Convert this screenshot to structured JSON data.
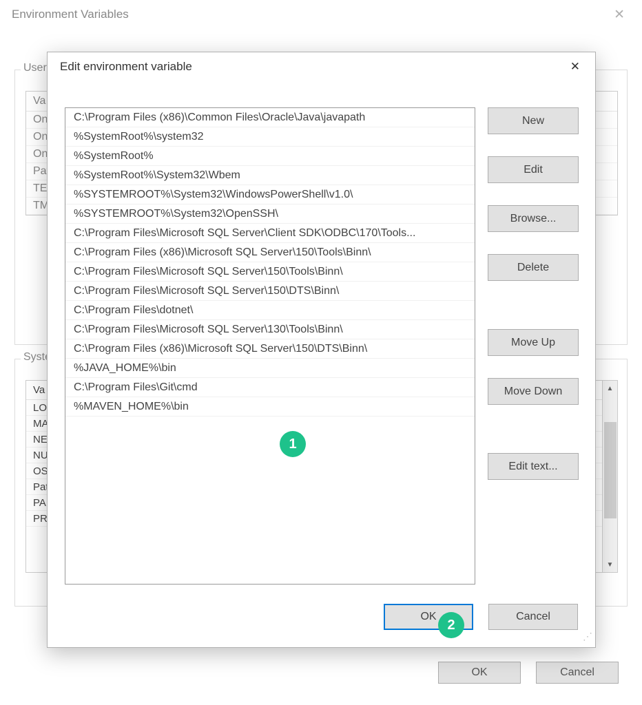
{
  "parent": {
    "title": "Environment Variables",
    "user_group_label": "User",
    "system_group_label": "Syste",
    "user_vars_header": "Va",
    "user_vars": [
      "On",
      "On",
      "On",
      "Pat",
      "TE",
      "TM"
    ],
    "system_vars_header": "Va",
    "system_vars": [
      "LO",
      "MA",
      "NE",
      "NU",
      "OS",
      "Pat",
      "PA",
      "PR"
    ],
    "ok_label": "OK",
    "cancel_label": "Cancel"
  },
  "modal": {
    "title": "Edit environment variable",
    "paths": [
      "C:\\Program Files (x86)\\Common Files\\Oracle\\Java\\javapath",
      "%SystemRoot%\\system32",
      "%SystemRoot%",
      "%SystemRoot%\\System32\\Wbem",
      "%SYSTEMROOT%\\System32\\WindowsPowerShell\\v1.0\\",
      "%SYSTEMROOT%\\System32\\OpenSSH\\",
      "C:\\Program Files\\Microsoft SQL Server\\Client SDK\\ODBC\\170\\Tools...",
      "C:\\Program Files (x86)\\Microsoft SQL Server\\150\\Tools\\Binn\\",
      "C:\\Program Files\\Microsoft SQL Server\\150\\Tools\\Binn\\",
      "C:\\Program Files\\Microsoft SQL Server\\150\\DTS\\Binn\\",
      "C:\\Program Files\\dotnet\\",
      "C:\\Program Files\\Microsoft SQL Server\\130\\Tools\\Binn\\",
      "C:\\Program Files (x86)\\Microsoft SQL Server\\150\\DTS\\Binn\\",
      "%JAVA_HOME%\\bin",
      "C:\\Program Files\\Git\\cmd",
      "%MAVEN_HOME%\\bin"
    ],
    "buttons": {
      "new": "New",
      "edit": "Edit",
      "browse": "Browse...",
      "delete": "Delete",
      "move_up": "Move Up",
      "move_down": "Move Down",
      "edit_text": "Edit text...",
      "ok": "OK",
      "cancel": "Cancel"
    }
  },
  "annotations": {
    "badge1": "1",
    "badge2": "2"
  }
}
